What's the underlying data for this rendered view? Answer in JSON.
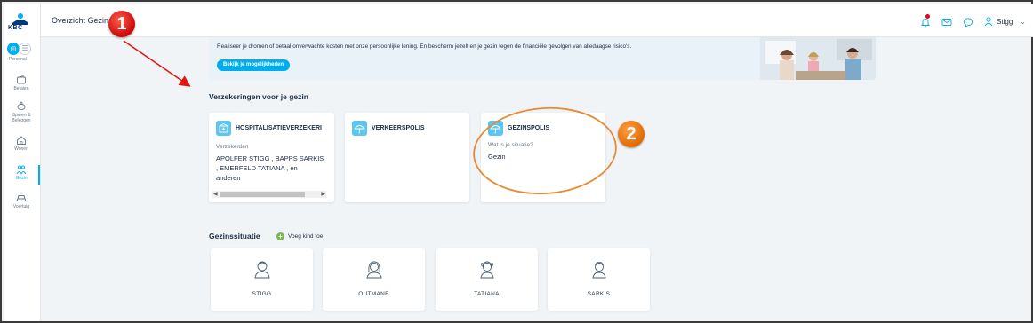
{
  "brand": {
    "logo_text": "KBC",
    "accent": "#00aeef",
    "navy": "#00387d"
  },
  "sidebar": {
    "persona": {
      "initials": "SS",
      "label": "Personal"
    },
    "items": [
      {
        "label": "Betalen",
        "icon": "wallet-icon"
      },
      {
        "label": "Sparen & Beleggen",
        "icon": "piggy-bank-icon"
      },
      {
        "label": "Wonen",
        "icon": "house-icon"
      },
      {
        "label": "Gezin",
        "icon": "family-icon",
        "active": true
      },
      {
        "label": "Voertuig",
        "icon": "car-icon"
      }
    ]
  },
  "header": {
    "breadcrumb": "Overzicht Gezin",
    "user": "Stigg"
  },
  "banner": {
    "text": "Realiseer je dromen of betaal onverwachte kosten met onze persoonlijke lening. En bescherm jezelf en je gezin tegen de financiële gevolgen van alledaagse risico's.",
    "button_label": "Bekijk je mogelijkheden"
  },
  "insurance": {
    "title": "Verzekeringen voor je gezin",
    "cards": [
      {
        "title": "HOSPITALISATIEVERZEKERI",
        "sub_label": "Verzekerden",
        "value_lines": [
          "APOLFER STIGG , BAPPS SARKIS",
          ", EMERFELD TATIANA , en",
          "anderen"
        ]
      },
      {
        "title": "VERKEERSPOLIS"
      },
      {
        "title": "GEZINSPOLIS",
        "sub_label": "Wat is je situatie?",
        "value": "Gezin"
      }
    ]
  },
  "family": {
    "title": "Gezinssituatie",
    "add_child_label": "Voeg kind toe",
    "members": [
      "STIGG",
      "OUTMANE",
      "TATIANA",
      "SARKIS"
    ]
  },
  "annotations": {
    "step1": "1",
    "step2": "2"
  }
}
